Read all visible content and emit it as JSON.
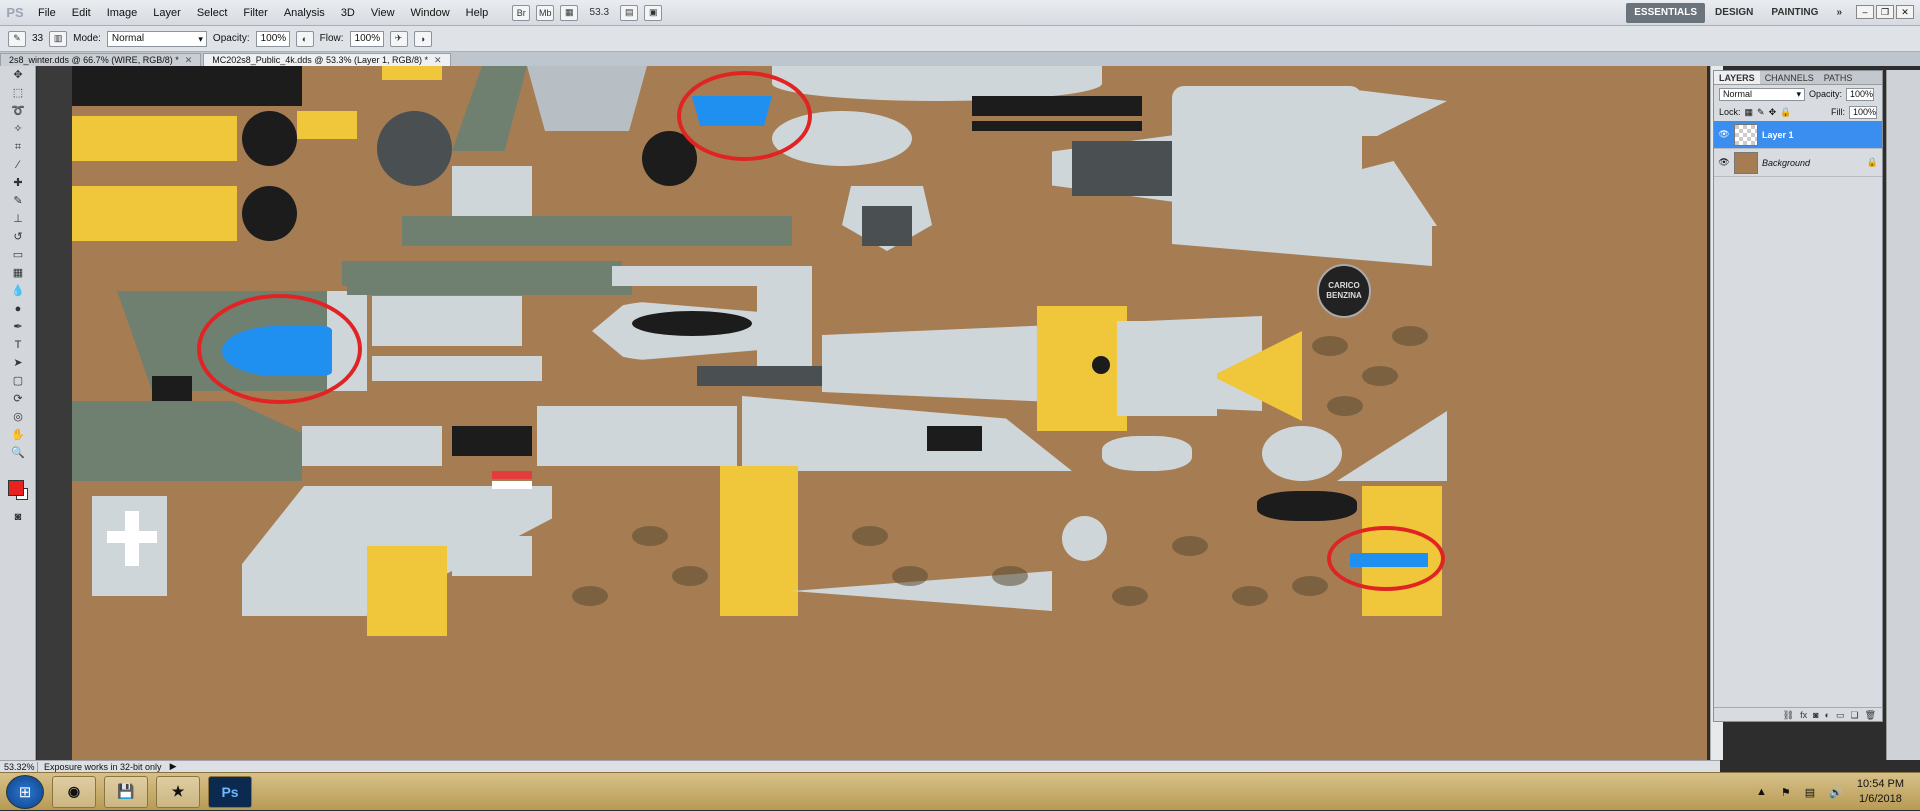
{
  "app": {
    "logo": "PS"
  },
  "menu": [
    "File",
    "Edit",
    "Image",
    "Layer",
    "Select",
    "Filter",
    "Analysis",
    "3D",
    "View",
    "Window",
    "Help"
  ],
  "menu_toolbar": {
    "br_label": "Br",
    "mb_label": "Mb",
    "zoom": "53.3"
  },
  "workspaces": {
    "active": "ESSENTIALS",
    "items": [
      "DESIGN",
      "PAINTING"
    ],
    "more": "»"
  },
  "options": {
    "brush_size": "33",
    "mode_label": "Mode:",
    "mode_value": "Normal",
    "opacity_label": "Opacity:",
    "opacity_value": "100%",
    "flow_label": "Flow:",
    "flow_value": "100%"
  },
  "tabs": [
    {
      "label": "2s8_winter.dds @ 66.7% (WIRE, RGB/8) *"
    },
    {
      "label": "MC202s8_Public_4k.dds @ 53.3% (Layer 1, RGB/8) *"
    }
  ],
  "canvas": {
    "badge_line1": "CARICO",
    "badge_line2": "BENZINA"
  },
  "status": {
    "zoom": "53.32%",
    "message": "Exposure works in 32-bit only"
  },
  "layers_panel": {
    "tabs": [
      "LAYERS",
      "CHANNELS",
      "PATHS"
    ],
    "blend_mode": "Normal",
    "opacity_label": "Opacity:",
    "opacity_value": "100%",
    "lock_label": "Lock:",
    "fill_label": "Fill:",
    "fill_value": "100%",
    "layers": [
      {
        "name": "Layer 1",
        "selected": true
      },
      {
        "name": "Background",
        "selected": false
      }
    ]
  },
  "taskbar": {
    "time": "10:54 PM",
    "date": "1/6/2018",
    "ps_label": "Ps"
  },
  "colors": {
    "foreground": "#e8231f",
    "background": "#ffffff",
    "selection": "#3a8ef0",
    "texture_base": "#a67c52"
  }
}
